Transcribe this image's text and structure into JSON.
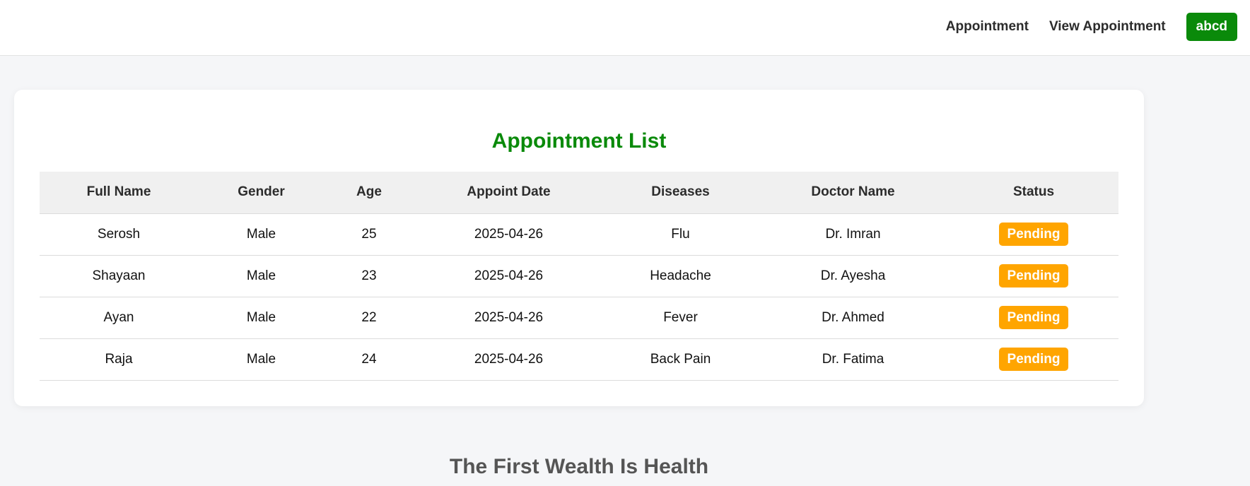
{
  "header": {
    "nav_links": [
      "Appointment",
      "View Appointment"
    ],
    "user_label": "abcd"
  },
  "main": {
    "title": "Appointment List",
    "table": {
      "columns": [
        "Full Name",
        "Gender",
        "Age",
        "Appoint Date",
        "Diseases",
        "Doctor Name",
        "Status"
      ],
      "rows": [
        [
          "Serosh",
          "Male",
          "25",
          "2025-04-26",
          "Flu",
          "Dr. Imran",
          "Pending"
        ],
        [
          "Shayaan",
          "Male",
          "23",
          "2025-04-26",
          "Headache",
          "Dr. Ayesha",
          "Pending"
        ],
        [
          "Ayan",
          "Male",
          "22",
          "2025-04-26",
          "Fever",
          "Dr. Ahmed",
          "Pending"
        ],
        [
          "Raja",
          "Male",
          "24",
          "2025-04-26",
          "Back Pain",
          "Dr. Fatima",
          "Pending"
        ]
      ]
    }
  },
  "footer": {
    "title": "The First Wealth Is Health"
  },
  "colors": {
    "accent_green": "#0a8a0a",
    "status_pending": "#ffa500"
  }
}
